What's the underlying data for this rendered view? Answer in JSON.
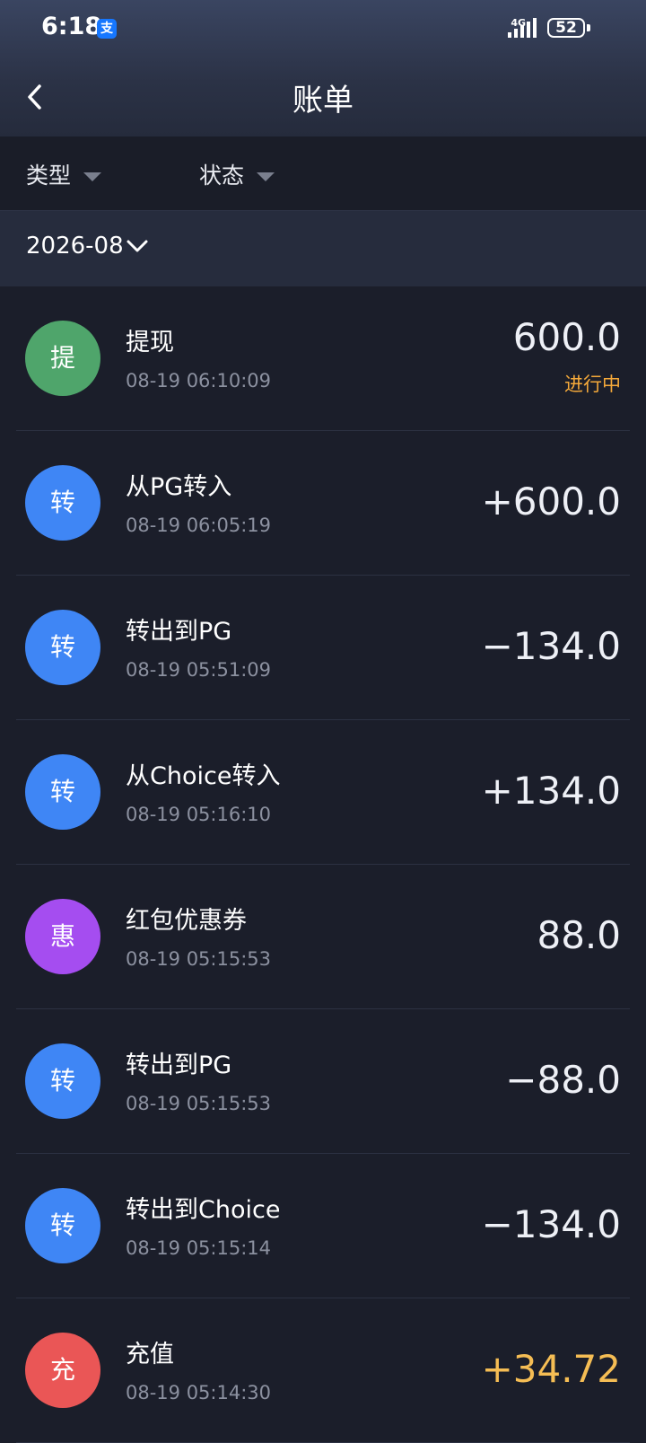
{
  "status_bar": {
    "time": "6:18",
    "app_icon": "支",
    "network": "4G",
    "battery": "52"
  },
  "header": {
    "title": "账单"
  },
  "filters": {
    "type_label": "类型",
    "status_label": "状态"
  },
  "month": {
    "label": "2026-08"
  },
  "colors": {
    "green": "#4fa56b",
    "blue": "#3f86f5",
    "purple": "#a54df0",
    "red": "#ea5656",
    "gold": "#f5bd54",
    "orange": "#f5a93a"
  },
  "transactions": [
    {
      "icon_char": "提",
      "icon_color": "#4fa56b",
      "title": "提现",
      "time": "08-19 06:10:09",
      "amount": "600.0",
      "status": "进行中"
    },
    {
      "icon_char": "转",
      "icon_color": "#3f86f5",
      "title": "从PG转入",
      "time": "08-19 06:05:19",
      "amount": "+600.0",
      "status": ""
    },
    {
      "icon_char": "转",
      "icon_color": "#3f86f5",
      "title": "转出到PG",
      "time": "08-19 05:51:09",
      "amount": "−134.0",
      "status": ""
    },
    {
      "icon_char": "转",
      "icon_color": "#3f86f5",
      "title": "从Choice转入",
      "time": "08-19 05:16:10",
      "amount": "+134.0",
      "status": ""
    },
    {
      "icon_char": "惠",
      "icon_color": "#a54df0",
      "title": "红包优惠券",
      "time": "08-19 05:15:53",
      "amount": "88.0",
      "status": ""
    },
    {
      "icon_char": "转",
      "icon_color": "#3f86f5",
      "title": "转出到PG",
      "time": "08-19 05:15:53",
      "amount": "−88.0",
      "status": ""
    },
    {
      "icon_char": "转",
      "icon_color": "#3f86f5",
      "title": "转出到Choice",
      "time": "08-19 05:15:14",
      "amount": "−134.0",
      "status": ""
    },
    {
      "icon_char": "充",
      "icon_color": "#ea5656",
      "title": "充值",
      "time": "08-19 05:14:30",
      "amount": "+34.72",
      "status": ""
    }
  ]
}
